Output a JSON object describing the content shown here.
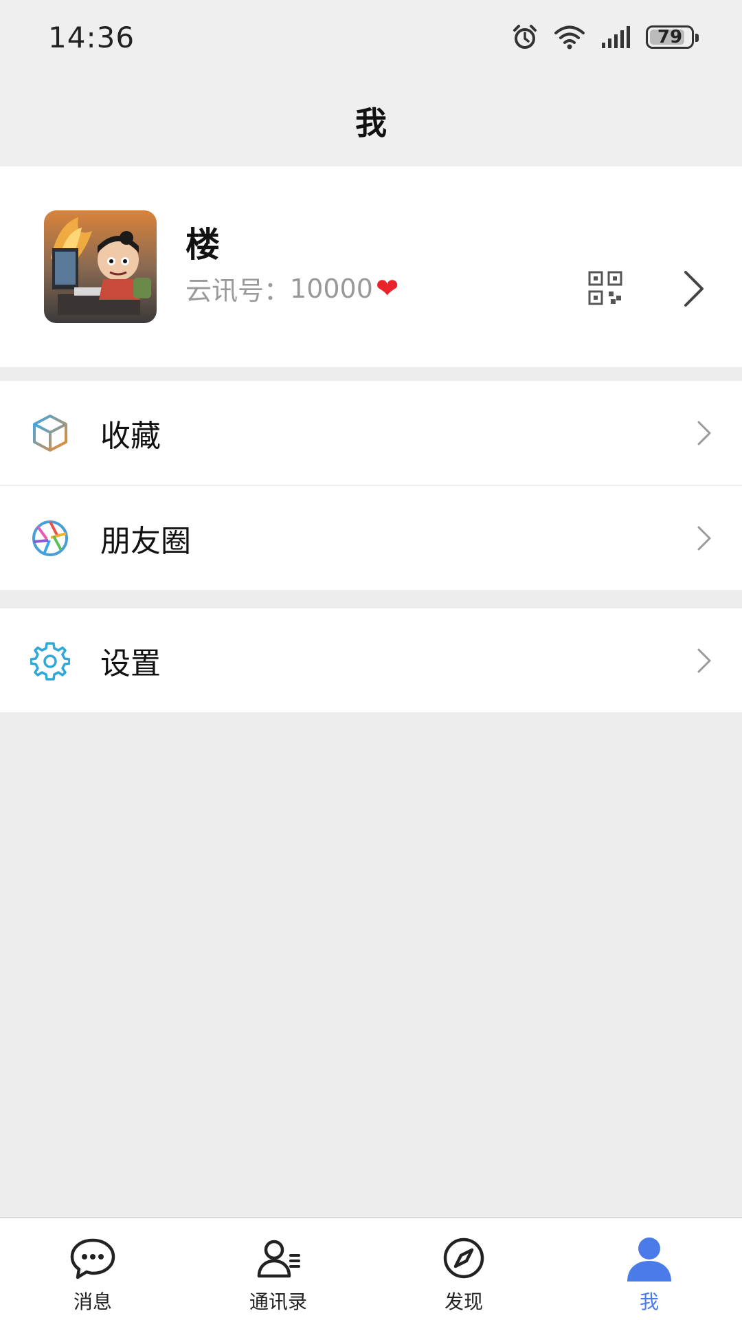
{
  "status_bar": {
    "time": "14:36",
    "battery_level": "79"
  },
  "header": {
    "title": "我"
  },
  "profile": {
    "name": "楼",
    "id_label": "云讯号：",
    "id_value": "10000"
  },
  "menu": {
    "favorites": "收藏",
    "moments": "朋友圈",
    "settings": "设置"
  },
  "tabs": [
    {
      "label": "消息"
    },
    {
      "label": "通讯录"
    },
    {
      "label": "发现"
    },
    {
      "label": "我"
    }
  ],
  "colors": {
    "accent": "#4a7be8",
    "background": "#ededed",
    "heart": "#e8242a"
  }
}
